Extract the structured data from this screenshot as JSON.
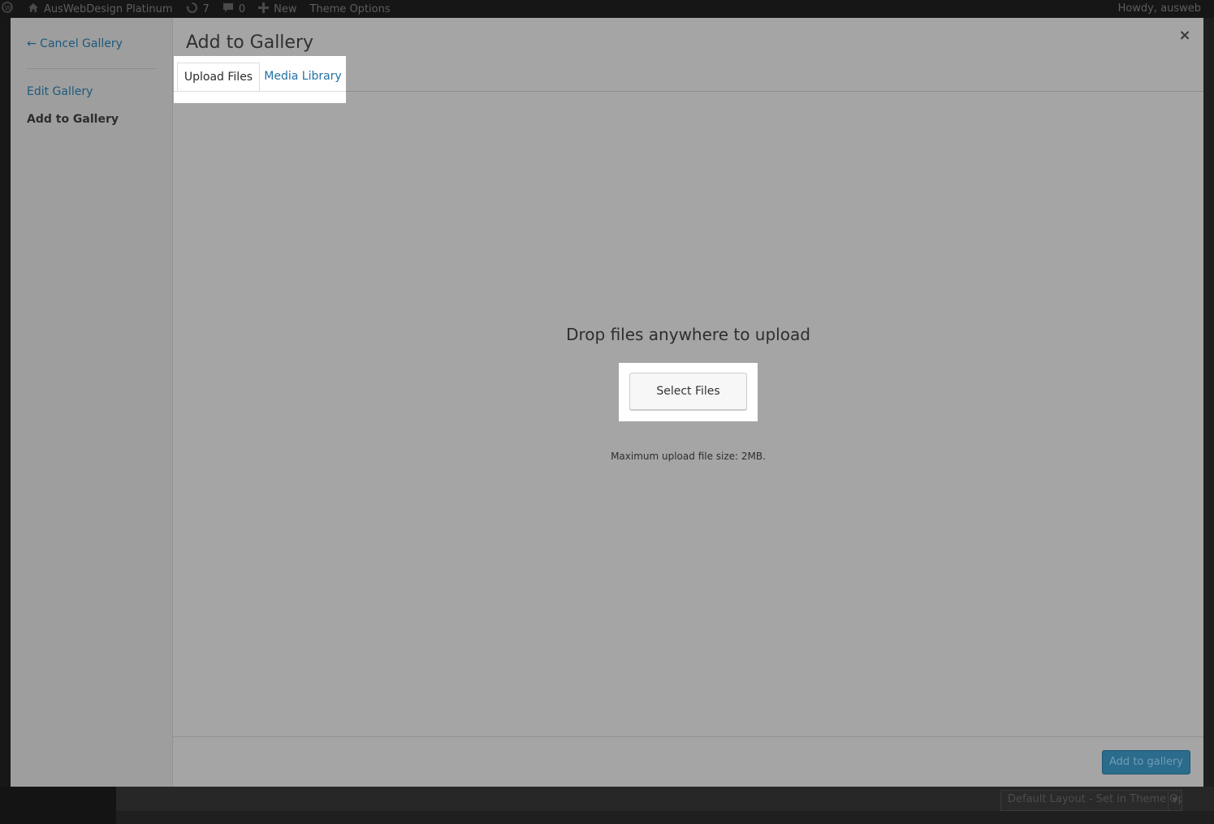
{
  "adminbar": {
    "site_name": "AusWebDesign Platinum",
    "updates_count": "7",
    "comments_count": "0",
    "new_label": "New",
    "theme_options_label": "Theme Options",
    "howdy": "Howdy, ausweb"
  },
  "background": {
    "layout_select_value": "Default Layout - Set in Theme Options"
  },
  "modal": {
    "title": "Add to Gallery",
    "close_glyph": "×",
    "menu": {
      "cancel_label": "← Cancel Gallery",
      "edit_label": "Edit Gallery",
      "add_label": "Add to Gallery"
    },
    "tabs": [
      {
        "label": "Upload Files",
        "active": true
      },
      {
        "label": "Media Library",
        "active": false
      }
    ],
    "upload": {
      "drop_text": "Drop files anywhere to upload",
      "select_button": "Select Files",
      "max_size": "Maximum upload file size: 2MB."
    },
    "toolbar": {
      "add_button": "Add to gallery"
    }
  },
  "colors": {
    "overlay_gray": "#a5a5a5",
    "link_blue": "#2271a6",
    "primary_button": "#2b6b8c",
    "highlight": "#ffffff"
  },
  "icons": [
    "wordpress-icon",
    "home-icon",
    "updates-icon",
    "comment-icon",
    "plus-icon",
    "close-icon"
  ]
}
